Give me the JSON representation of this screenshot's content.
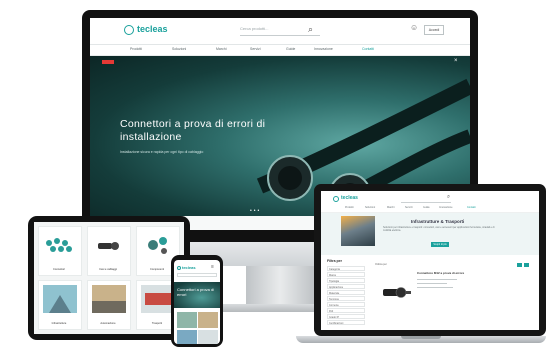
{
  "site": {
    "logo_text": "tecleas",
    "search_placeholder": "Cerca prodotti...",
    "access_label": "Accedi",
    "nav": [
      "Prodotti",
      "Soluzioni",
      "Marchi",
      "Servizi",
      "Guide",
      "Innovazione",
      "Contatti"
    ]
  },
  "hero": {
    "title": "Connettori a prova di errori di installazione",
    "subtitle": "Installazione sicura e rapida per ogni tipo di cablaggio"
  },
  "laptop": {
    "banner_title": "Infrastrutture & Trasporti",
    "banner_text": "Soluzioni per infrastrutture e trasporti: connettori, cavi e accessori per applicazioni ferroviarie, stradali e di mobilità elettrica.",
    "banner_button": "Scopri di più",
    "filter_title": "Filtra per",
    "filters": [
      "Categoria",
      "Marca",
      "Tipologia",
      "Applicazione",
      "Materiale",
      "Tensione",
      "Corrente",
      "Poli",
      "Grado IP",
      "Certificazioni"
    ],
    "product_title": "Connettore M12 a prova di errore",
    "toolbar_label": "Ordina per"
  },
  "tablet": {
    "cards": [
      {
        "caption": "Connettori"
      },
      {
        "caption": "Cavi e cablaggi"
      },
      {
        "caption": "Componenti"
      },
      {
        "caption": "Infrastrutture"
      },
      {
        "caption": "Automazione"
      },
      {
        "caption": "Trasporti"
      }
    ]
  },
  "phone": {
    "hero_title": "Connettori a prova di errori"
  },
  "colors": {
    "brand": "#1aa19c",
    "hero_dark": "#143c3a",
    "accent_red": "#e53935"
  }
}
